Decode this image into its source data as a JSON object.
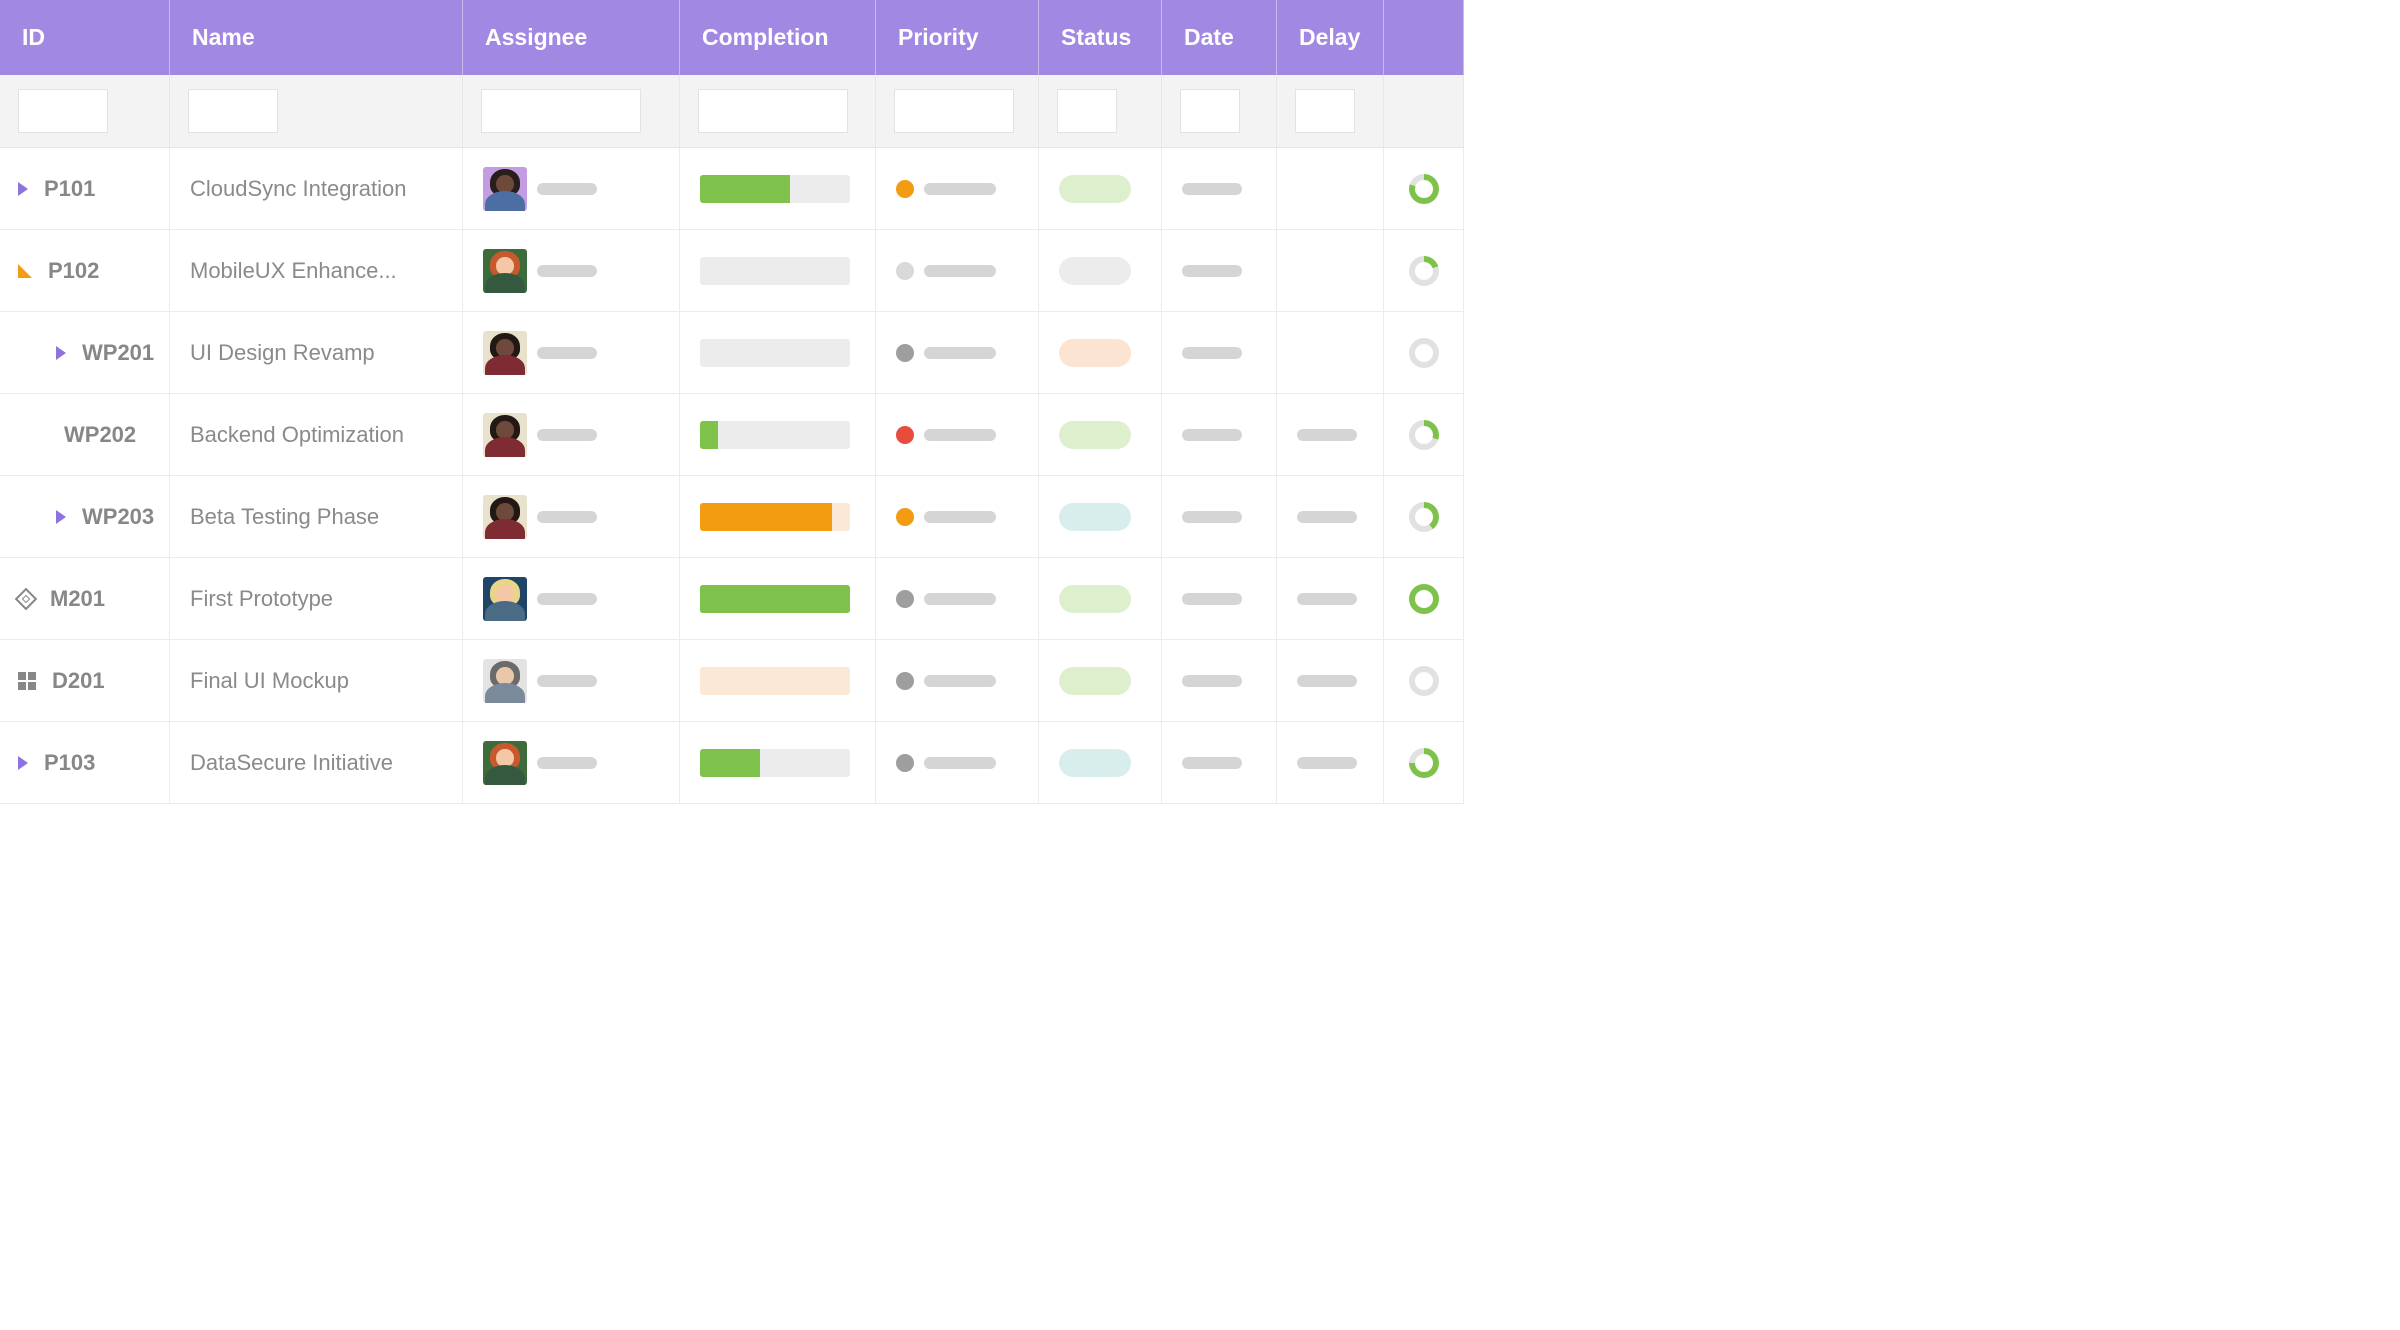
{
  "colors": {
    "header_bg": "#A189E3",
    "purple": "#8E72DE",
    "orange": "#F39C12",
    "green": "#7EC24B",
    "red": "#E74C3C",
    "grey": "#9E9E9E",
    "status_green": "#DDEFCD",
    "status_grey": "#ECECEC",
    "status_peach": "#FCE4D2",
    "status_teal": "#D7EEEC"
  },
  "columns": [
    {
      "key": "id",
      "label": "ID",
      "filter_width": 90
    },
    {
      "key": "name",
      "label": "Name",
      "filter_width": 90
    },
    {
      "key": "assignee",
      "label": "Assignee",
      "filter_width": 160
    },
    {
      "key": "completion",
      "label": "Completion",
      "filter_width": 150
    },
    {
      "key": "priority",
      "label": "Priority",
      "filter_width": 120
    },
    {
      "key": "status",
      "label": "Status",
      "filter_width": 60
    },
    {
      "key": "date",
      "label": "Date",
      "filter_width": 60
    },
    {
      "key": "delay",
      "label": "Delay",
      "filter_width": 60
    },
    {
      "key": "ring",
      "label": "",
      "filter_width": 0
    }
  ],
  "rows": [
    {
      "id": "P101",
      "name": "CloudSync Integration",
      "indent": 0,
      "icon": "chev-purple",
      "avatar": {
        "bg": "#C49CE3",
        "skin": "#6E4A3C",
        "hair": "#2A1E1A",
        "shirt": "#4C6EA3"
      },
      "completion": {
        "pct": 60,
        "fill": "#7EC24B",
        "bg": "#ECECEC"
      },
      "priority_color": "#F39C12",
      "status_color": "#DDEFCD",
      "has_date": true,
      "has_delay": false,
      "ring": {
        "color": "#7EC24B",
        "pct": 80
      }
    },
    {
      "id": "P102",
      "name": "MobileUX Enhance...",
      "indent": 0,
      "icon": "tri-orange",
      "avatar": {
        "bg": "#3E6B3B",
        "skin": "#F4C7A6",
        "hair": "#C65A2E",
        "shirt": "#35593F"
      },
      "completion": {
        "pct": 0,
        "fill": "#ECECEC",
        "bg": "#ECECEC"
      },
      "priority_color": "#D9D9D9",
      "status_color": "#ECECEC",
      "has_date": true,
      "has_delay": false,
      "ring": {
        "color": "#7EC24B",
        "pct": 20
      }
    },
    {
      "id": "WP201",
      "name": "UI Design Revamp",
      "indent": 1,
      "icon": "chev-purple",
      "avatar": {
        "bg": "#E8E2CC",
        "skin": "#6E4A3C",
        "hair": "#221814",
        "shirt": "#7E2B34"
      },
      "completion": {
        "pct": 0,
        "fill": "#ECECEC",
        "bg": "#ECECEC"
      },
      "priority_color": "#9E9E9E",
      "status_color": "#FCE4D2",
      "has_date": true,
      "has_delay": false,
      "ring": {
        "color": "#E5E5E5",
        "pct": 0
      }
    },
    {
      "id": "WP202",
      "name": "Backend Optimization",
      "indent": 2,
      "icon": "none",
      "avatar": {
        "bg": "#E8E2CC",
        "skin": "#6E4A3C",
        "hair": "#221814",
        "shirt": "#7E2B34"
      },
      "completion": {
        "pct": 12,
        "fill": "#7EC24B",
        "bg": "#ECECEC"
      },
      "priority_color": "#E74C3C",
      "status_color": "#DDEFCD",
      "has_date": true,
      "has_delay": true,
      "ring": {
        "color": "#7EC24B",
        "pct": 30
      }
    },
    {
      "id": "WP203",
      "name": "Beta Testing Phase",
      "indent": 1,
      "icon": "chev-purple",
      "avatar": {
        "bg": "#E8E2CC",
        "skin": "#6E4A3C",
        "hair": "#221814",
        "shirt": "#7E2B34"
      },
      "completion": {
        "pct": 88,
        "fill": "#F39C12",
        "bg": "#FCE8D6"
      },
      "priority_color": "#F39C12",
      "status_color": "#D7EEEC",
      "has_date": true,
      "has_delay": true,
      "ring": {
        "color": "#7EC24B",
        "pct": 40
      }
    },
    {
      "id": "M201",
      "name": "First Prototype",
      "indent": 0,
      "icon": "diamond",
      "avatar": {
        "bg": "#1F4467",
        "skin": "#F4C7A6",
        "hair": "#E8D58A",
        "shirt": "#4A6B84"
      },
      "completion": {
        "pct": 100,
        "fill": "#7EC24B",
        "bg": "#7EC24B"
      },
      "priority_color": "#9E9E9E",
      "status_color": "#DDEFCD",
      "has_date": true,
      "has_delay": true,
      "ring": {
        "color": "#7EC24B",
        "pct": 100
      }
    },
    {
      "id": "D201",
      "name": "Final UI Mockup",
      "indent": 0,
      "icon": "squares",
      "avatar": {
        "bg": "#E3E3E3",
        "skin": "#E8C8A8",
        "hair": "#6B6B6B",
        "shirt": "#7A8A9A"
      },
      "completion": {
        "pct": 0,
        "fill": "#FCE8D6",
        "bg": "#FCE8D6"
      },
      "priority_color": "#9E9E9E",
      "status_color": "#DDEFCD",
      "has_date": true,
      "has_delay": true,
      "ring": {
        "color": "#E5E5E5",
        "pct": 0
      }
    },
    {
      "id": "P103",
      "name": "DataSecure Initiative",
      "indent": 0,
      "icon": "chev-purple",
      "avatar": {
        "bg": "#3E6B3B",
        "skin": "#F4C7A6",
        "hair": "#C65A2E",
        "shirt": "#35593F"
      },
      "completion": {
        "pct": 40,
        "fill": "#7EC24B",
        "bg": "#ECECEC"
      },
      "priority_color": "#9E9E9E",
      "status_color": "#D7EEEC",
      "has_date": true,
      "has_delay": true,
      "ring": {
        "color": "#7EC24B",
        "pct": 75
      }
    }
  ]
}
